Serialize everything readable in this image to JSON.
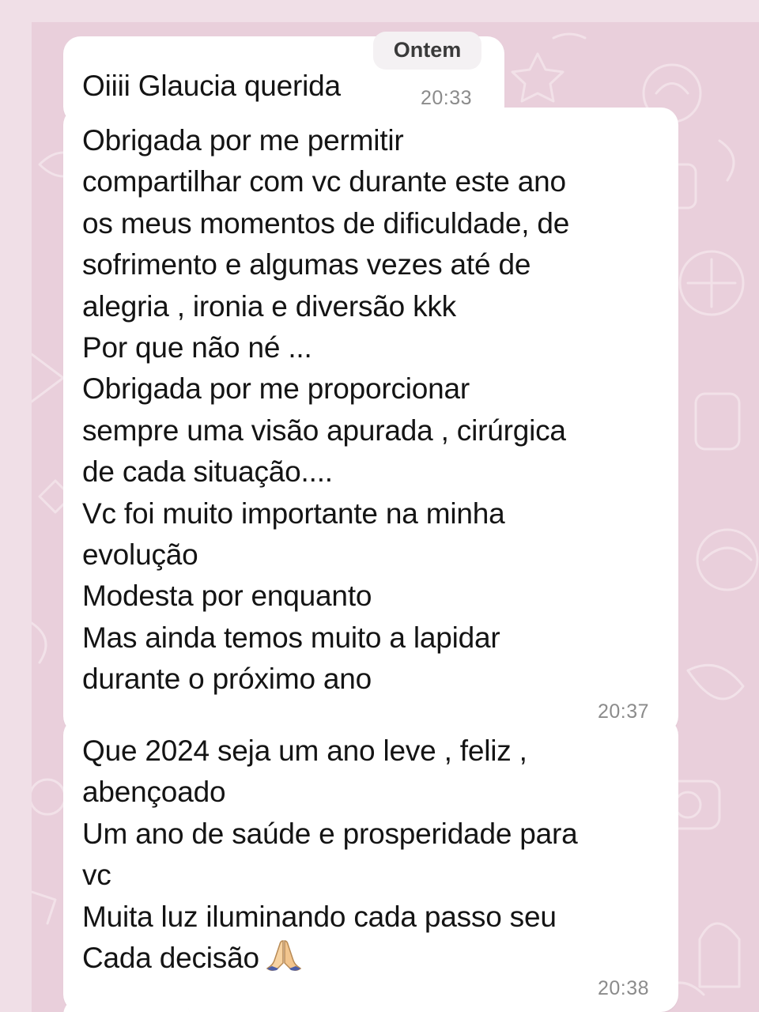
{
  "date_chip": "Ontem",
  "messages": [
    {
      "text": "Oiiii Glaucia querida",
      "time": "20:33"
    },
    {
      "text": "Obrigada por me permitir\ncompartilhar com vc durante este ano\nos meus momentos de dificuldade, de\nsofrimento e algumas vezes até de\nalegria , ironia e diversão kkk\nPor que não né ...\nObrigada por me proporcionar\nsempre uma visão apurada , cirúrgica\nde cada  situação....\nVc foi muito importante na minha\nevolução\nModesta por enquanto\nMas ainda temos muito a lapidar\ndurante o próximo ano",
      "time": "20:37"
    },
    {
      "text": "Que 2024 seja um ano leve , feliz ,\nabençoado\nUm ano de saúde e prosperidade para\nvc\nMuita luz iluminando cada passo seu\nCada decisão",
      "emoji": "folded-hands-icon",
      "time": "20:38"
    }
  ],
  "colors": {
    "wallpaper": "#e9cfdb",
    "frame": "#f0dfe7",
    "bubble": "#ffffff",
    "timestamp": "#8b8b8b"
  }
}
